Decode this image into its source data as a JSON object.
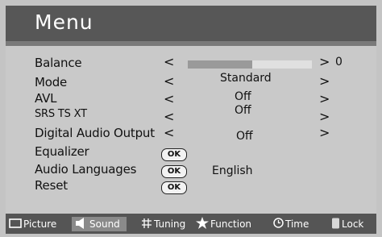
{
  "menu": {
    "title": "Menu"
  },
  "rows": {
    "balance": {
      "label": "Balance",
      "left_arrow": "<",
      "right_arrow": ">",
      "value": "0",
      "level": 0.52
    },
    "mode": {
      "label": "Mode",
      "left_arrow": "<",
      "right_arrow": ">",
      "value": "Standard"
    },
    "avl": {
      "label": "AVL",
      "left_arrow": "<",
      "right_arrow": ">",
      "value": "Off"
    },
    "srs": {
      "label": "SRS TS XT",
      "left_arrow": "<",
      "right_arrow": ">",
      "value": "Off"
    },
    "digital_audio": {
      "label": "Digital Audio Output",
      "left_arrow": "<",
      "right_arrow": ">",
      "value": "Off"
    },
    "equalizer": {
      "label": "Equalizer",
      "button": "OK"
    },
    "audio_languages": {
      "label": "Audio Languages",
      "button": "OK",
      "value": "English"
    },
    "reset": {
      "label": "Reset",
      "button": "OK"
    }
  },
  "footer": {
    "items": [
      {
        "label": "Picture",
        "icon": "picture-icon"
      },
      {
        "label": "Sound",
        "icon": "speaker-icon",
        "active": true
      },
      {
        "label": "Tuning",
        "icon": "tuning-icon"
      },
      {
        "label": "Function",
        "icon": "star-icon"
      },
      {
        "label": "Time",
        "icon": "clock-icon"
      },
      {
        "label": "Lock",
        "icon": "lock-icon"
      }
    ]
  },
  "colors": {
    "title_bg": "#575757",
    "panel_bg": "#c9c9c9",
    "footer_bg": "#555555",
    "active_tab_bg": "#8a8a8a"
  }
}
